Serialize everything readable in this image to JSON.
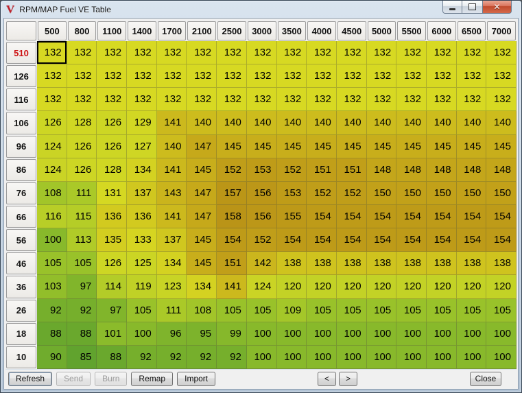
{
  "window": {
    "title": "RPM/MAP Fuel VE Table",
    "icon": "v-logo",
    "icon_glyph": "V"
  },
  "table": {
    "column_headers": [
      "500",
      "800",
      "1100",
      "1400",
      "1700",
      "2100",
      "2500",
      "3000",
      "3500",
      "4000",
      "4500",
      "5000",
      "5500",
      "6000",
      "6500",
      "7000"
    ],
    "row_headers": [
      "510",
      "126",
      "116",
      "106",
      "96",
      "86",
      "76",
      "66",
      "56",
      "46",
      "36",
      "26",
      "18",
      "10"
    ],
    "rows": [
      [
        132,
        132,
        132,
        132,
        132,
        132,
        132,
        132,
        132,
        132,
        132,
        132,
        132,
        132,
        132,
        132
      ],
      [
        132,
        132,
        132,
        132,
        132,
        132,
        132,
        132,
        132,
        132,
        132,
        132,
        132,
        132,
        132,
        132
      ],
      [
        132,
        132,
        132,
        132,
        132,
        132,
        132,
        132,
        132,
        132,
        132,
        132,
        132,
        132,
        132,
        132
      ],
      [
        126,
        128,
        126,
        129,
        141,
        140,
        140,
        140,
        140,
        140,
        140,
        140,
        140,
        140,
        140,
        140
      ],
      [
        124,
        126,
        126,
        127,
        140,
        147,
        145,
        145,
        145,
        145,
        145,
        145,
        145,
        145,
        145,
        145
      ],
      [
        124,
        126,
        128,
        134,
        141,
        145,
        152,
        153,
        152,
        151,
        151,
        148,
        148,
        148,
        148,
        148
      ],
      [
        108,
        111,
        131,
        137,
        143,
        147,
        157,
        156,
        153,
        152,
        152,
        150,
        150,
        150,
        150,
        150
      ],
      [
        116,
        115,
        136,
        136,
        141,
        147,
        158,
        156,
        155,
        154,
        154,
        154,
        154,
        154,
        154,
        154
      ],
      [
        100,
        113,
        135,
        133,
        137,
        145,
        154,
        152,
        154,
        154,
        154,
        154,
        154,
        154,
        154,
        154
      ],
      [
        105,
        105,
        126,
        125,
        134,
        145,
        151,
        142,
        138,
        138,
        138,
        138,
        138,
        138,
        138,
        138
      ],
      [
        103,
        97,
        114,
        119,
        123,
        134,
        141,
        124,
        120,
        120,
        120,
        120,
        120,
        120,
        120,
        120
      ],
      [
        92,
        92,
        97,
        105,
        111,
        108,
        105,
        105,
        109,
        105,
        105,
        105,
        105,
        105,
        105,
        105
      ],
      [
        88,
        88,
        101,
        100,
        96,
        95,
        99,
        100,
        100,
        100,
        100,
        100,
        100,
        100,
        100,
        100
      ],
      [
        90,
        85,
        88,
        92,
        92,
        92,
        92,
        100,
        100,
        100,
        100,
        100,
        100,
        100,
        100,
        100
      ]
    ],
    "selected_cell": {
      "row": 0,
      "col": 0
    },
    "highlighted_row_header_index": 0,
    "highlighted_row_header_color": "#cc1111"
  },
  "heatmap": {
    "stops": [
      {
        "value": 85,
        "color": "#61a32e"
      },
      {
        "value": 92,
        "color": "#76af2c"
      },
      {
        "value": 100,
        "color": "#88b92b"
      },
      {
        "value": 105,
        "color": "#99c22a"
      },
      {
        "value": 112,
        "color": "#adca28"
      },
      {
        "value": 120,
        "color": "#c3d226"
      },
      {
        "value": 132,
        "color": "#d7d922"
      },
      {
        "value": 138,
        "color": "#cfc31e"
      },
      {
        "value": 141,
        "color": "#ccb91d"
      },
      {
        "value": 145,
        "color": "#c8ae1b"
      },
      {
        "value": 150,
        "color": "#c2a119"
      },
      {
        "value": 158,
        "color": "#ba9417"
      }
    ]
  },
  "toolbar": {
    "buttons": [
      {
        "label": "Refresh",
        "enabled": true
      },
      {
        "label": "Send",
        "enabled": false
      },
      {
        "label": "Burn",
        "enabled": false
      },
      {
        "label": "Remap",
        "enabled": true
      },
      {
        "label": "Import",
        "enabled": true
      }
    ],
    "pager_prev": "<",
    "pager_next": ">",
    "close_label": "Close"
  }
}
